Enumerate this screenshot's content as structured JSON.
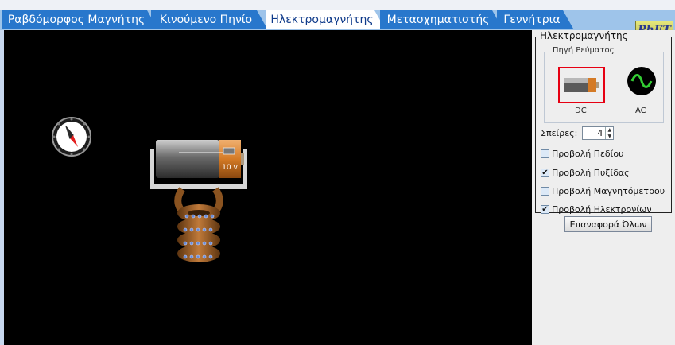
{
  "tabs": [
    {
      "label": "Ραβδόμορφος Μαγνήτης",
      "active": false
    },
    {
      "label": "Κινούμενο Πηνίο",
      "active": false
    },
    {
      "label": "Ηλεκτρομαγνήτης",
      "active": true
    },
    {
      "label": "Μετασχηματιστής",
      "active": false
    },
    {
      "label": "Γεννήτρια",
      "active": false
    }
  ],
  "logo": "PhET",
  "simulation": {
    "battery_voltage": "10 v",
    "compass_icon": "compass-icon",
    "battery_icon": "battery-icon",
    "coil_icon": "coil-icon"
  },
  "panel": {
    "title": "Ηλεκτρομαγνήτης",
    "current_source": {
      "title": "Πηγή Ρεύματος",
      "dc_label": "DC",
      "ac_label": "AC",
      "selected": "DC"
    },
    "turns": {
      "label": "Σπείρες:",
      "value": "4"
    },
    "checkboxes": [
      {
        "label": "Προβολή Πεδίου",
        "checked": false
      },
      {
        "label": "Προβολή Πυξίδας",
        "checked": true
      },
      {
        "label": "Προβολή Μαγνητόμετρου",
        "checked": false
      },
      {
        "label": "Προβολή Ηλεκτρονίων",
        "checked": true
      }
    ],
    "reset_label": "Επαναφορά Όλων"
  },
  "colors": {
    "tab_blue": "#2877cc",
    "selection_red": "#e60012",
    "background": "#000000"
  }
}
